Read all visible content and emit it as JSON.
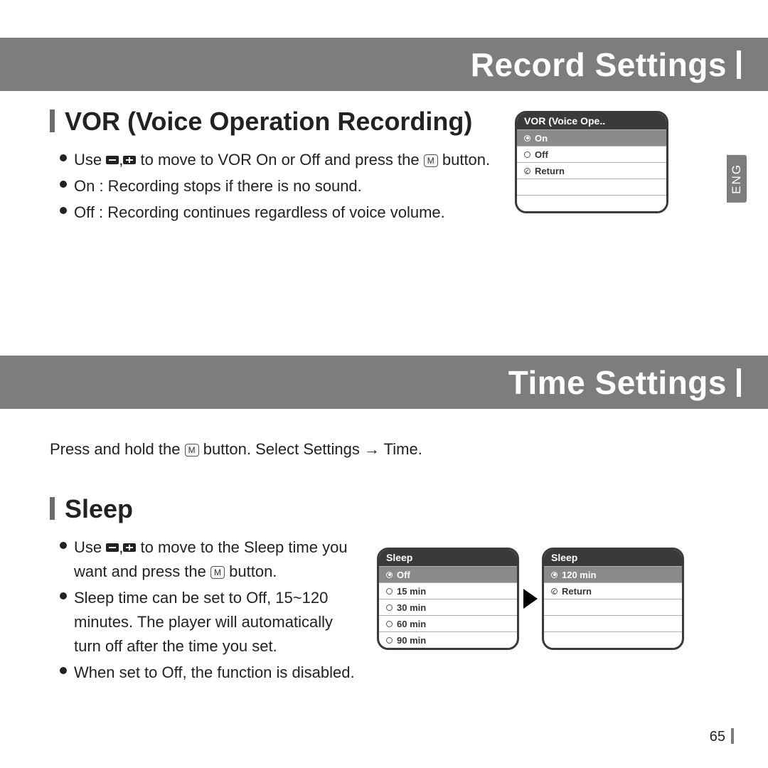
{
  "banner1": "Record Settings",
  "banner2": "Time Settings",
  "langtab": "ENG",
  "page_number": "65",
  "vor": {
    "heading": "VOR (Voice Operation Recording)",
    "line1a": "Use ",
    "line1b": " to move to VOR On or Off and press the ",
    "line1c": " button.",
    "line2": "On : Recording stops if there is no sound.",
    "line3": "Off : Recording continues regardless of voice volume.",
    "lcd": {
      "title": "VOR (Voice Ope..",
      "opt_on": "On",
      "opt_off": "Off",
      "opt_return": "Return"
    }
  },
  "time_intro_a": "Press and hold the ",
  "time_intro_b": " button. Select Settings → Time.",
  "sleep": {
    "heading": "Sleep",
    "b1a": "Use ",
    "b1b": " to move to the Sleep time you want and press the ",
    "b1c": " button.",
    "b2": "Sleep time can be set to Off, 15~120 minutes. The player will automatically turn off after the time you set.",
    "b3": "When set to Off, the function is disabled.",
    "lcd1": {
      "title": "Sleep",
      "r1": "Off",
      "r2": "15 min",
      "r3": "30 min",
      "r4": "60 min",
      "r5": "90 min"
    },
    "lcd2": {
      "title": "Sleep",
      "r1": "120 min",
      "r2": "Return"
    }
  }
}
